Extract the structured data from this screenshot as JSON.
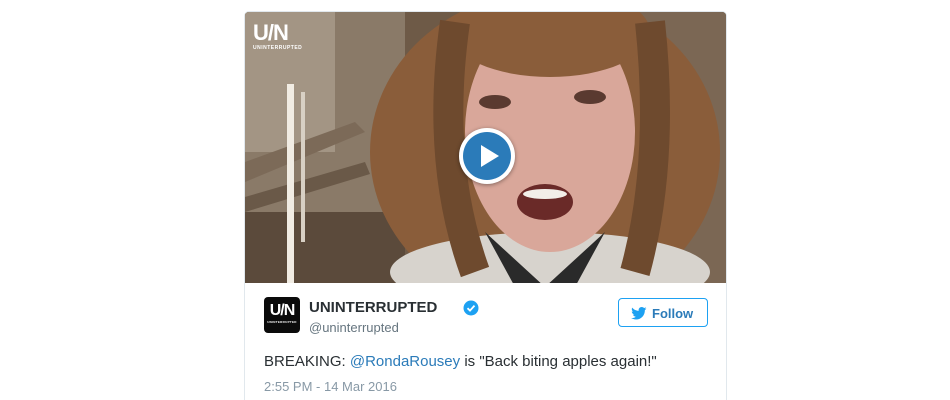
{
  "tweet": {
    "watermark": {
      "logo": "U/N",
      "sub": "UNINTERRUPTED"
    },
    "avatar": {
      "logo": "U/N",
      "sub": "UNINTERRUPTED"
    },
    "user": {
      "name": "UNINTERRUPTED",
      "handle": "@uninterrupted",
      "verified": true
    },
    "follow_label": "Follow",
    "text": {
      "prefix": "BREAKING: ",
      "mention": "@RondaRousey",
      "suffix": " is \"Back biting apples again!\""
    },
    "timestamp": "2:55 PM - 14 Mar 2016",
    "icons": {
      "play": "play-icon",
      "verified": "verified-badge-icon",
      "follow": "twitter-bird-icon"
    },
    "colors": {
      "link": "#2b7bb9",
      "play": "#2b7bb9",
      "follow_border": "#1da1f2",
      "verified": "#1da1f2"
    }
  }
}
